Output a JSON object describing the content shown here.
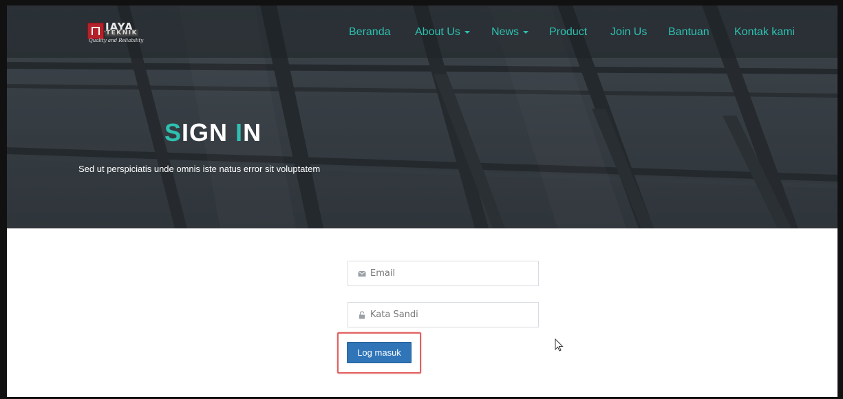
{
  "brand": {
    "name_line1": "JAYA",
    "name_line2": "TEKNIK",
    "tagline": "Quality and Reliability"
  },
  "nav": {
    "items": [
      {
        "label": "Beranda",
        "dropdown": false
      },
      {
        "label": "About Us",
        "dropdown": true
      },
      {
        "label": "News",
        "dropdown": true
      },
      {
        "label": "Product",
        "dropdown": false
      },
      {
        "label": "Join Us",
        "dropdown": false
      },
      {
        "label": "Bantuan",
        "dropdown": false
      },
      {
        "label": "Kontak kami",
        "dropdown": false
      }
    ]
  },
  "hero": {
    "title_first_letter": "S",
    "title_first_rest": "IGN",
    "title_second_letter": "I",
    "title_second_rest": "N",
    "subtitle": "Sed ut perspiciatis unde omnis iste natus error sit voluptatem"
  },
  "form": {
    "email_placeholder": "Email",
    "email_value": "",
    "password_placeholder": "Kata Sandi",
    "password_value": "",
    "submit_label": "Log masuk"
  },
  "colors": {
    "accent": "#2ec0b1",
    "button": "#2f75b8",
    "highlight": "#e0605f"
  },
  "icons": {
    "email": "envelope-icon",
    "password": "lock-icon"
  }
}
